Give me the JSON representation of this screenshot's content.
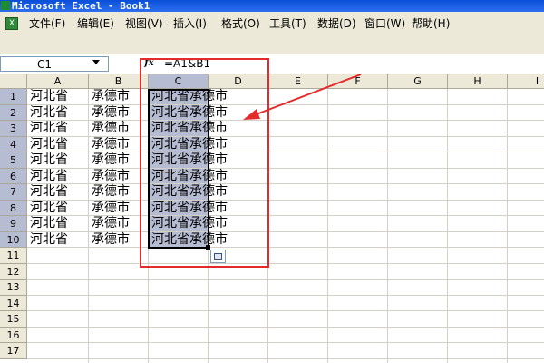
{
  "window": {
    "title": "Microsoft Excel - Book1"
  },
  "menu": {
    "items": [
      "文件(F)",
      "编辑(E)",
      "视图(V)",
      "插入(I)",
      "格式(O)",
      "工具(T)",
      "数据(D)",
      "窗口(W)",
      "帮助(H)"
    ]
  },
  "formula_bar": {
    "name_box": "C1",
    "fx_label": "fx",
    "formula": "=A1&B1"
  },
  "sheet": {
    "columns": [
      "A",
      "B",
      "C",
      "D",
      "E",
      "F",
      "G",
      "H",
      "I"
    ],
    "rows": [
      "1",
      "2",
      "3",
      "4",
      "5",
      "6",
      "7",
      "8",
      "9",
      "10",
      "11",
      "12",
      "13",
      "14",
      "15",
      "16",
      "17"
    ],
    "active_column": "C",
    "data": [
      [
        "河北省",
        "承德市",
        "河北省承德市"
      ],
      [
        "河北省",
        "承德市",
        "河北省承德市"
      ],
      [
        "河北省",
        "承德市",
        "河北省承德市"
      ],
      [
        "河北省",
        "承德市",
        "河北省承德市"
      ],
      [
        "河北省",
        "承德市",
        "河北省承德市"
      ],
      [
        "河北省",
        "承德市",
        "河北省承德市"
      ],
      [
        "河北省",
        "承德市",
        "河北省承德市"
      ],
      [
        "河北省",
        "承德市",
        "河北省承德市"
      ],
      [
        "河北省",
        "承德市",
        "河北省承德市"
      ],
      [
        "河北省",
        "承德市",
        "河北省承德市"
      ]
    ]
  },
  "colors": {
    "selection": "#b6bdd2",
    "annotation": "#e32b2b",
    "titlebar": "#0a4fd8"
  }
}
